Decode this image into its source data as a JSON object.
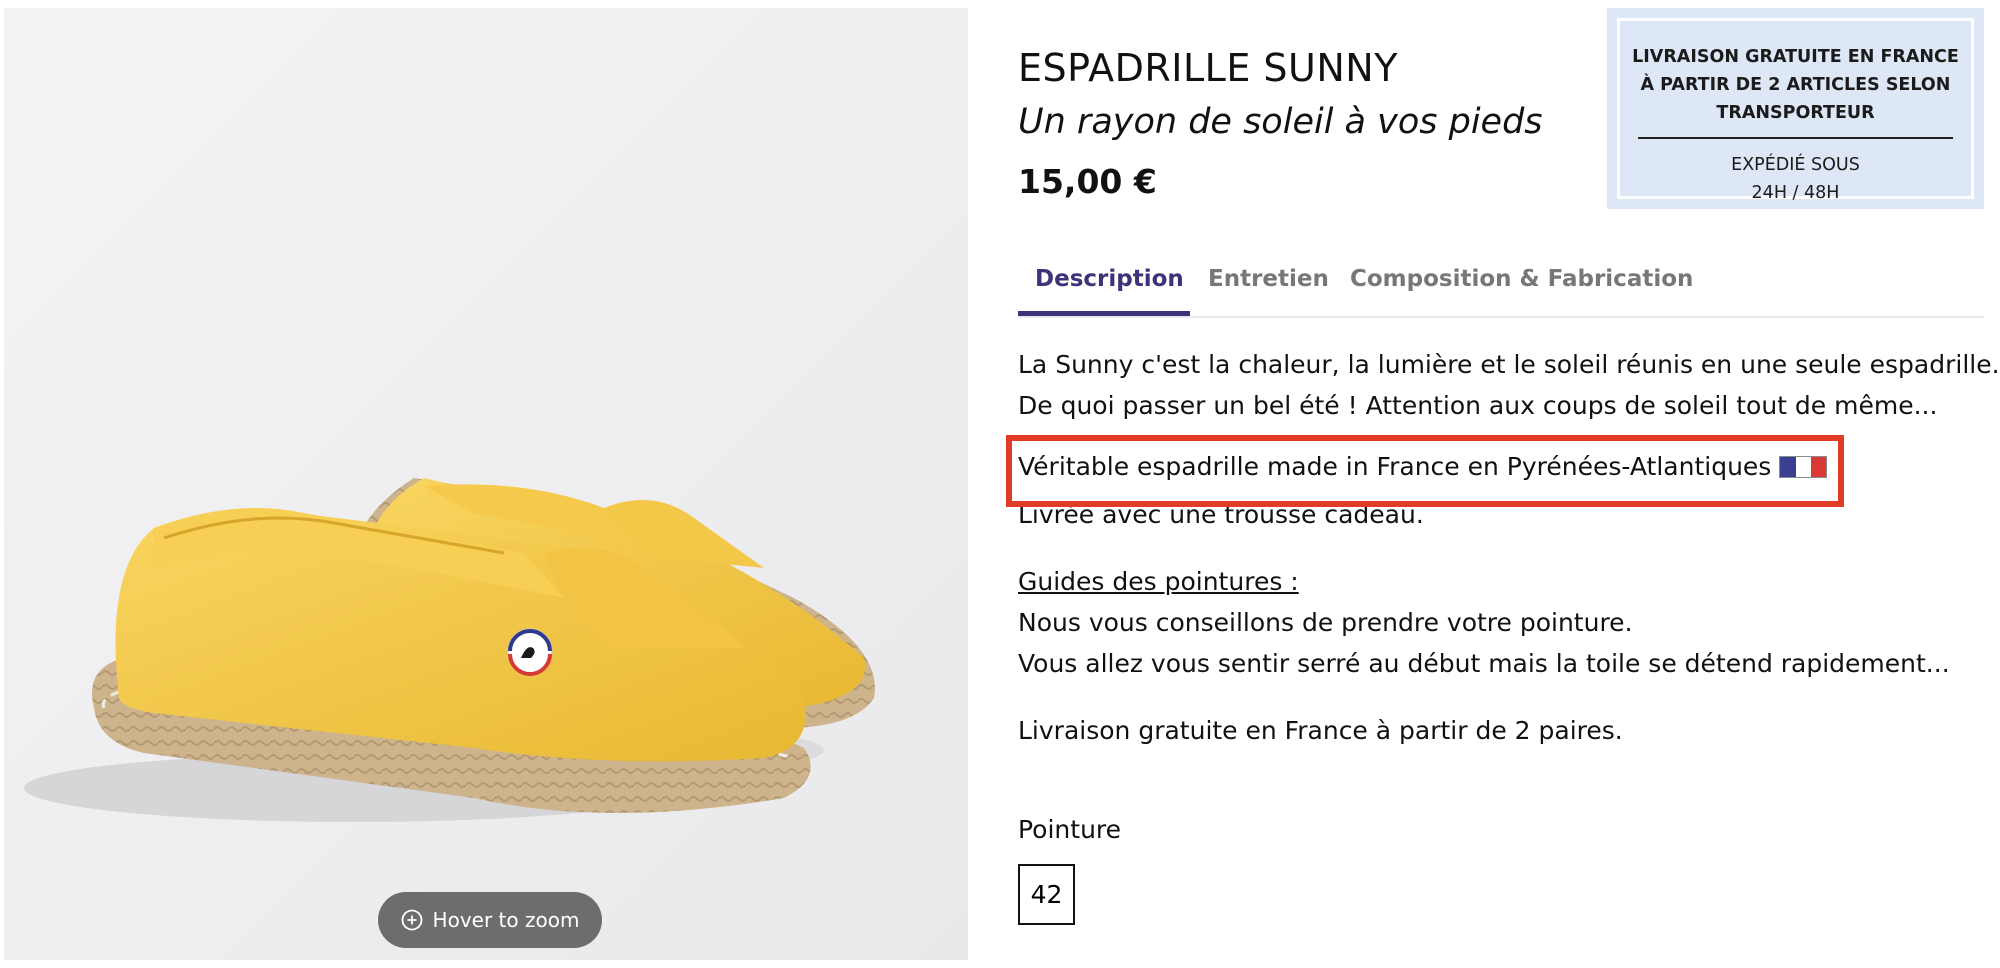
{
  "gallery": {
    "zoom_label": "Hover to zoom",
    "zoom_icon": "plus-circle-icon"
  },
  "product": {
    "title": "ESPADRILLE SUNNY",
    "subtitle": "Un rayon de soleil à vos pieds",
    "price": "15,00 €"
  },
  "shipping": {
    "headline": "LIVRAISON GRATUITE EN FRANCE À PARTIR DE 2 ARTICLES SELON TRANSPORTEUR",
    "line1": "EXPÉDIÉ SOUS",
    "line2": "24H / 48H"
  },
  "tabs": [
    {
      "label": "Description",
      "active": true
    },
    {
      "label": "Entretien",
      "active": false
    },
    {
      "label": "Composition & Fabrication",
      "active": false
    }
  ],
  "description": {
    "line1": "La Sunny c'est la chaleur, la lumière et le soleil réunis en une seule espadrille.",
    "line2": "De quoi passer un bel été ! Attention aux coups de soleil tout de même...",
    "made_in": "Véritable espadrille made in France en Pyrénées-Atlantiques",
    "delivered_with": "Livrée avec une trousse cadeau.",
    "guide_heading": "Guides des pointures :",
    "guide_line1": "Nous vous conseillons de prendre votre pointure.",
    "guide_line2": "Vous allez vous sentir serré au début mais la toile se détend rapidement...",
    "free_delivery": "Livraison gratuite en France à partir de 2 paires."
  },
  "size": {
    "label": "Pointure",
    "options": [
      "42"
    ]
  },
  "colors": {
    "accent": "#3b3478",
    "highlight": "#e23b27",
    "shipping_bg": "#dde7f6",
    "flag": [
      "#3a3f8f",
      "#ffffff",
      "#d93a35"
    ]
  }
}
